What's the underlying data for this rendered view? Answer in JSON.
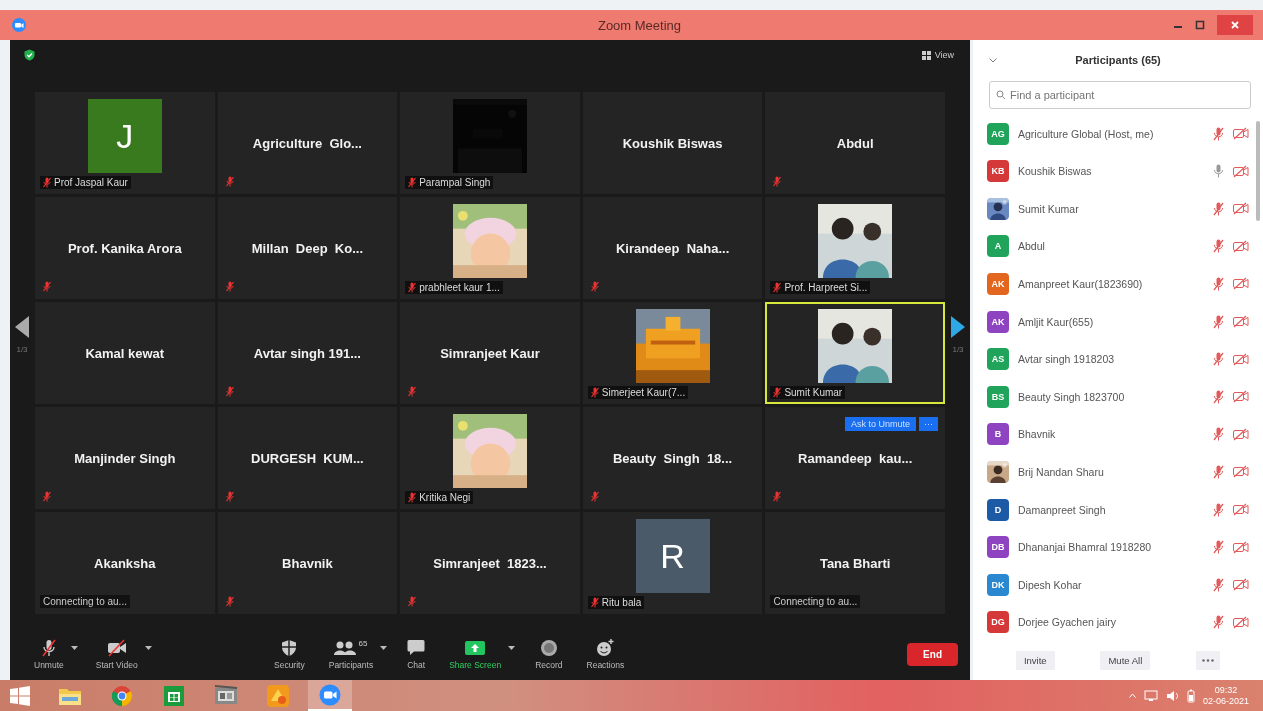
{
  "window": {
    "title": "Zoom Meeting"
  },
  "meeting": {
    "view_button": "View",
    "page_left": "1/3",
    "page_right": "1/3",
    "tiles": [
      {
        "kind": "avatar",
        "letter": "J",
        "color": "#3a7a1f",
        "caption": "Prof Jaspal Kaur",
        "muted": true,
        "speaking": false
      },
      {
        "kind": "name",
        "name": "Agriculture  Glo...",
        "muted": true,
        "speaking": false
      },
      {
        "kind": "picture",
        "caption": "Parampal Singh",
        "muted": true,
        "speaking": false
      },
      {
        "kind": "name",
        "name": "Koushik Biswas",
        "muted": false,
        "speaking": false
      },
      {
        "kind": "name",
        "name": "Abdul",
        "muted": true,
        "speaking": false
      },
      {
        "kind": "name",
        "name": "Prof. Kanika Arora",
        "muted": true,
        "speaking": false
      },
      {
        "kind": "name",
        "name": "Millan  Deep  Ko...",
        "muted": true,
        "speaking": false
      },
      {
        "kind": "picture",
        "caption": "prabhleet kaur 1...",
        "muted": true,
        "speaking": false
      },
      {
        "kind": "name",
        "name": "Kirandeep  Naha...",
        "muted": true,
        "speaking": false
      },
      {
        "kind": "picture",
        "caption": "Prof. Harpreet Si...",
        "muted": true,
        "speaking": false
      },
      {
        "kind": "name",
        "name": "Kamal kewat",
        "muted": false,
        "speaking": false
      },
      {
        "kind": "name",
        "name": "Avtar singh 191...",
        "muted": true,
        "speaking": false
      },
      {
        "kind": "name",
        "name": "Simranjeet Kaur",
        "muted": true,
        "speaking": false
      },
      {
        "kind": "picture",
        "caption": "Simerjeet Kaur(7...",
        "muted": true,
        "speaking": false
      },
      {
        "kind": "picture",
        "caption": "Sumit Kumar",
        "muted": true,
        "speaking": true
      },
      {
        "kind": "name",
        "name": "Manjinder Singh",
        "muted": true,
        "speaking": false
      },
      {
        "kind": "name",
        "name": "DURGESH  KUM...",
        "muted": true,
        "speaking": false
      },
      {
        "kind": "picture",
        "caption": "Kritika Negi",
        "muted": true,
        "speaking": false
      },
      {
        "kind": "name",
        "name": "Beauty  Singh  18...",
        "muted": true,
        "speaking": false
      },
      {
        "kind": "name",
        "name": "Ramandeep  kau...",
        "muted": true,
        "speaking": false
      },
      {
        "kind": "name",
        "name": "Akanksha",
        "status": "Connecting to au...",
        "muted": false,
        "speaking": false
      },
      {
        "kind": "name",
        "name": "Bhavnik",
        "muted": true,
        "speaking": false
      },
      {
        "kind": "name",
        "name": "Simranjeet  1823...",
        "muted": true,
        "speaking": false
      },
      {
        "kind": "avatar",
        "letter": "R",
        "color": "#4a5a68",
        "caption": "Ritu bala",
        "muted": true,
        "speaking": false
      },
      {
        "kind": "name",
        "name": "Tana Bharti",
        "status": "Connecting to au...",
        "muted": false,
        "speaking": false
      }
    ],
    "ask_button": "Ask to Unmute",
    "more_button": "···"
  },
  "toolbar": [
    {
      "kind": "mic",
      "label": "Unmute",
      "caret": true
    },
    {
      "kind": "video",
      "label": "Start Video",
      "caret": true
    },
    {
      "kind": "security",
      "label": "Security",
      "caret": false
    },
    {
      "kind": "participants",
      "label": "Participants",
      "count": "65",
      "caret": true
    },
    {
      "kind": "chat",
      "label": "Chat",
      "caret": false
    },
    {
      "kind": "share",
      "label": "Share Screen",
      "caret": true
    },
    {
      "kind": "record",
      "label": "Record",
      "caret": false
    },
    {
      "kind": "reactions",
      "label": "Reactions",
      "caret": false
    }
  ],
  "end_button": "End",
  "participants_panel": {
    "title": "Participants (65)",
    "search": {
      "placeholder": "Find a participant"
    },
    "rows": [
      {
        "initials": "AG",
        "color": "#20a35a",
        "name": "Agriculture Global (Host, me)",
        "muted": true
      },
      {
        "initials": "KB",
        "color": "#d43838",
        "name": "Koushik Biswas",
        "muted": false
      },
      {
        "kind": "picture",
        "name": "Sumit Kumar",
        "muted": true
      },
      {
        "initials": "A",
        "color": "#20a35a",
        "name": "Abdul",
        "muted": true
      },
      {
        "initials": "AK",
        "color": "#e2661e",
        "name": "Amanpreet Kaur(1823690)",
        "muted": true
      },
      {
        "initials": "AK",
        "color": "#8e44c0",
        "name": "Amljit Kaur(655)",
        "muted": true
      },
      {
        "initials": "AS",
        "color": "#20a35a",
        "name": "Avtar singh 1918203",
        "muted": true
      },
      {
        "initials": "BS",
        "color": "#20a35a",
        "name": "Beauty Singh 1823700",
        "muted": true
      },
      {
        "initials": "B",
        "color": "#8e44c0",
        "name": "Bhavnik",
        "muted": true
      },
      {
        "kind": "picture",
        "name": "Brij Nandan Sharu",
        "muted": true
      },
      {
        "initials": "D",
        "color": "#1c5aa6",
        "name": "Damanpreet Singh",
        "muted": true
      },
      {
        "initials": "DB",
        "color": "#8e44c0",
        "name": "Dhananjai Bhamral 1918280",
        "muted": true
      },
      {
        "initials": "DK",
        "color": "#2a88d0",
        "name": "Dipesh Kohar",
        "muted": true
      },
      {
        "initials": "DG",
        "color": "#d43838",
        "name": "Dorjee Gyachen jairy",
        "muted": true
      }
    ],
    "buttons": [
      "Invite",
      "Mute All"
    ]
  },
  "taskbar": {
    "apps": [
      {
        "kind": "explorer",
        "selected": false
      },
      {
        "kind": "chrome",
        "selected": false
      },
      {
        "kind": "store",
        "selected": false
      },
      {
        "kind": "film",
        "selected": false
      },
      {
        "kind": "app",
        "selected": false
      },
      {
        "kind": "zoom",
        "selected": true
      }
    ],
    "time": "09:32",
    "date": "02-06-2021"
  }
}
